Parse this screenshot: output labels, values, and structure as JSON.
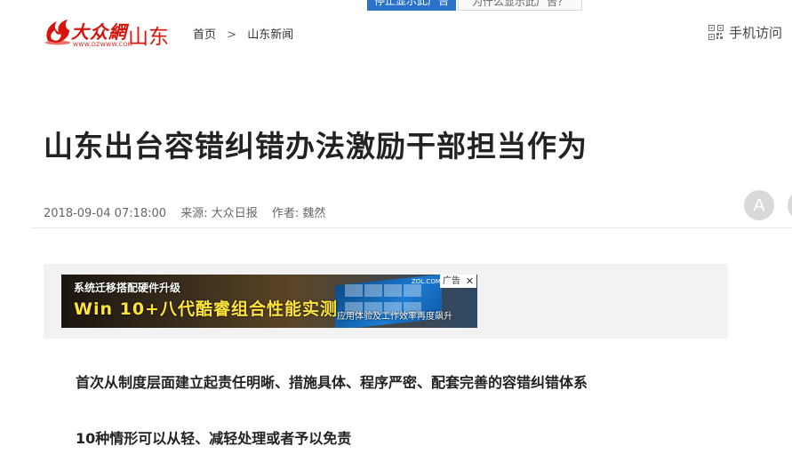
{
  "top_bar": {
    "left_button": "停止显示此广告",
    "right_button": "为什么显示此广告？"
  },
  "header": {
    "logo_text": "大众網",
    "logo_url": "WWW.DZWWW.COM",
    "logo_region": "山东",
    "breadcrumb": [
      "首页",
      "山东新闻"
    ],
    "breadcrumb_sep": ">",
    "mobile_label": "手机访问"
  },
  "article": {
    "title": "山东出台容错纠错办法激励干部担当作为",
    "datetime": "2018-09-04 07:18:00",
    "source": "来源: 大众日报",
    "author": "作者: 魏然",
    "font_button": "A",
    "paragraphs": [
      "首次从制度层面建立起责任明晰、措施具体、程序严密、配套完善的容错纠错体系",
      "10种情形可以从轻、减轻处理或者予以免责"
    ]
  },
  "ad": {
    "line1": "系统迁移搭配硬件升级",
    "line2": "Win 10+八代酷睿组合性能实测",
    "line3": "应用体验及工作效率再度飙升",
    "brand": "ZOL.COM.CN",
    "badge": "广告",
    "close": "✕"
  },
  "colors": {
    "brand_red": "#d7140c",
    "top_blue": "#2a72c9",
    "ad_yellow": "#ffe43a",
    "ad_bg": "#f2f2f2"
  },
  "icons": [
    "flame-logo-icon",
    "qr-code-icon",
    "font-size-icon",
    "close-icon"
  ]
}
